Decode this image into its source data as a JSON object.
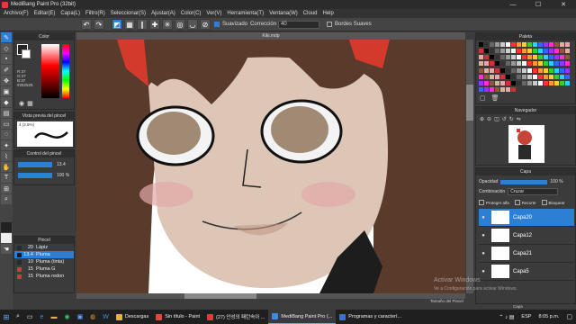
{
  "window": {
    "title": "MediBang Paint Pro (32bit)",
    "minimize": "—",
    "maximize": "☐",
    "close": "✕"
  },
  "menu": [
    "Archivo(F)",
    "Editar(E)",
    "Capa(L)",
    "Filtro(R)",
    "Seleccionar(S)",
    "Ajustar(A)",
    "Color(C)",
    "Ver(V)",
    "Herramienta(T)",
    "Ventana(W)",
    "Cloud",
    "Help"
  ],
  "toolbar": {
    "smooth_label": "Suavizado",
    "correction_label": "Corrección",
    "correction_value": "40",
    "edge_label": "Bordes Suaves"
  },
  "canvas": {
    "tab": "Kiki.mdp"
  },
  "color_panel": {
    "title": "Color",
    "r": "R:37",
    "g": "G:37",
    "b": "B:37",
    "hex": "#252525"
  },
  "brush_preview": {
    "title": "Vista previa del pincel",
    "size": "4 (2.5%)"
  },
  "brush_control": {
    "title": "Control del pincel",
    "size": "13.4",
    "opacity": "100 %"
  },
  "brush_list": {
    "title": "Pincel",
    "items": [
      {
        "size": "20",
        "name": "Lápiz",
        "color": "#2a2a2a"
      },
      {
        "size": "13.4",
        "name": "Pluma",
        "color": "#1a1a1a"
      },
      {
        "size": "10",
        "name": "Pluma (tinta)",
        "color": "#2a2a2a"
      },
      {
        "size": "15",
        "name": "Pluma G",
        "color": "#d23a3a"
      },
      {
        "size": "15",
        "name": "Pluma redon",
        "color": "#d23a3a"
      }
    ],
    "selected_index": 1
  },
  "palette": {
    "title": "Paleta"
  },
  "navigator": {
    "title": "Navegador"
  },
  "layers": {
    "title": "Capa",
    "opacity_label": "Opacidad",
    "opacity_value": "100 %",
    "blend_label": "Combinación",
    "blend_value": "Cruzar",
    "protect_alpha": "Proteger alfa",
    "clipping": "Recorte",
    "lock": "Bloquear",
    "items": [
      "Capa20",
      "Capa12",
      "Capa21",
      "Capa5"
    ],
    "selected_index": 0,
    "brush_size_footer": "Tamaño del Pincel",
    "layer_footer": "Capa"
  },
  "watermark": {
    "line1": "Activar Windows",
    "line2": "Ve a Configuración para activar Windows."
  },
  "taskbar": {
    "items": [
      {
        "label": "Descargas",
        "color": "#e8b23a"
      },
      {
        "label": "Sin título - Paint",
        "color": "#d84c3a"
      },
      {
        "label": "(27) 안성의 패턴속아 ...",
        "color": "#e23b3b"
      },
      {
        "label": "MediBang Paint Pro (...",
        "color": "#3a8de0"
      },
      {
        "label": "Programas y caracterí...",
        "color": "#3a6fd8"
      }
    ],
    "active_index": 3,
    "lang": "ESP",
    "time": "8:05 p.m."
  }
}
